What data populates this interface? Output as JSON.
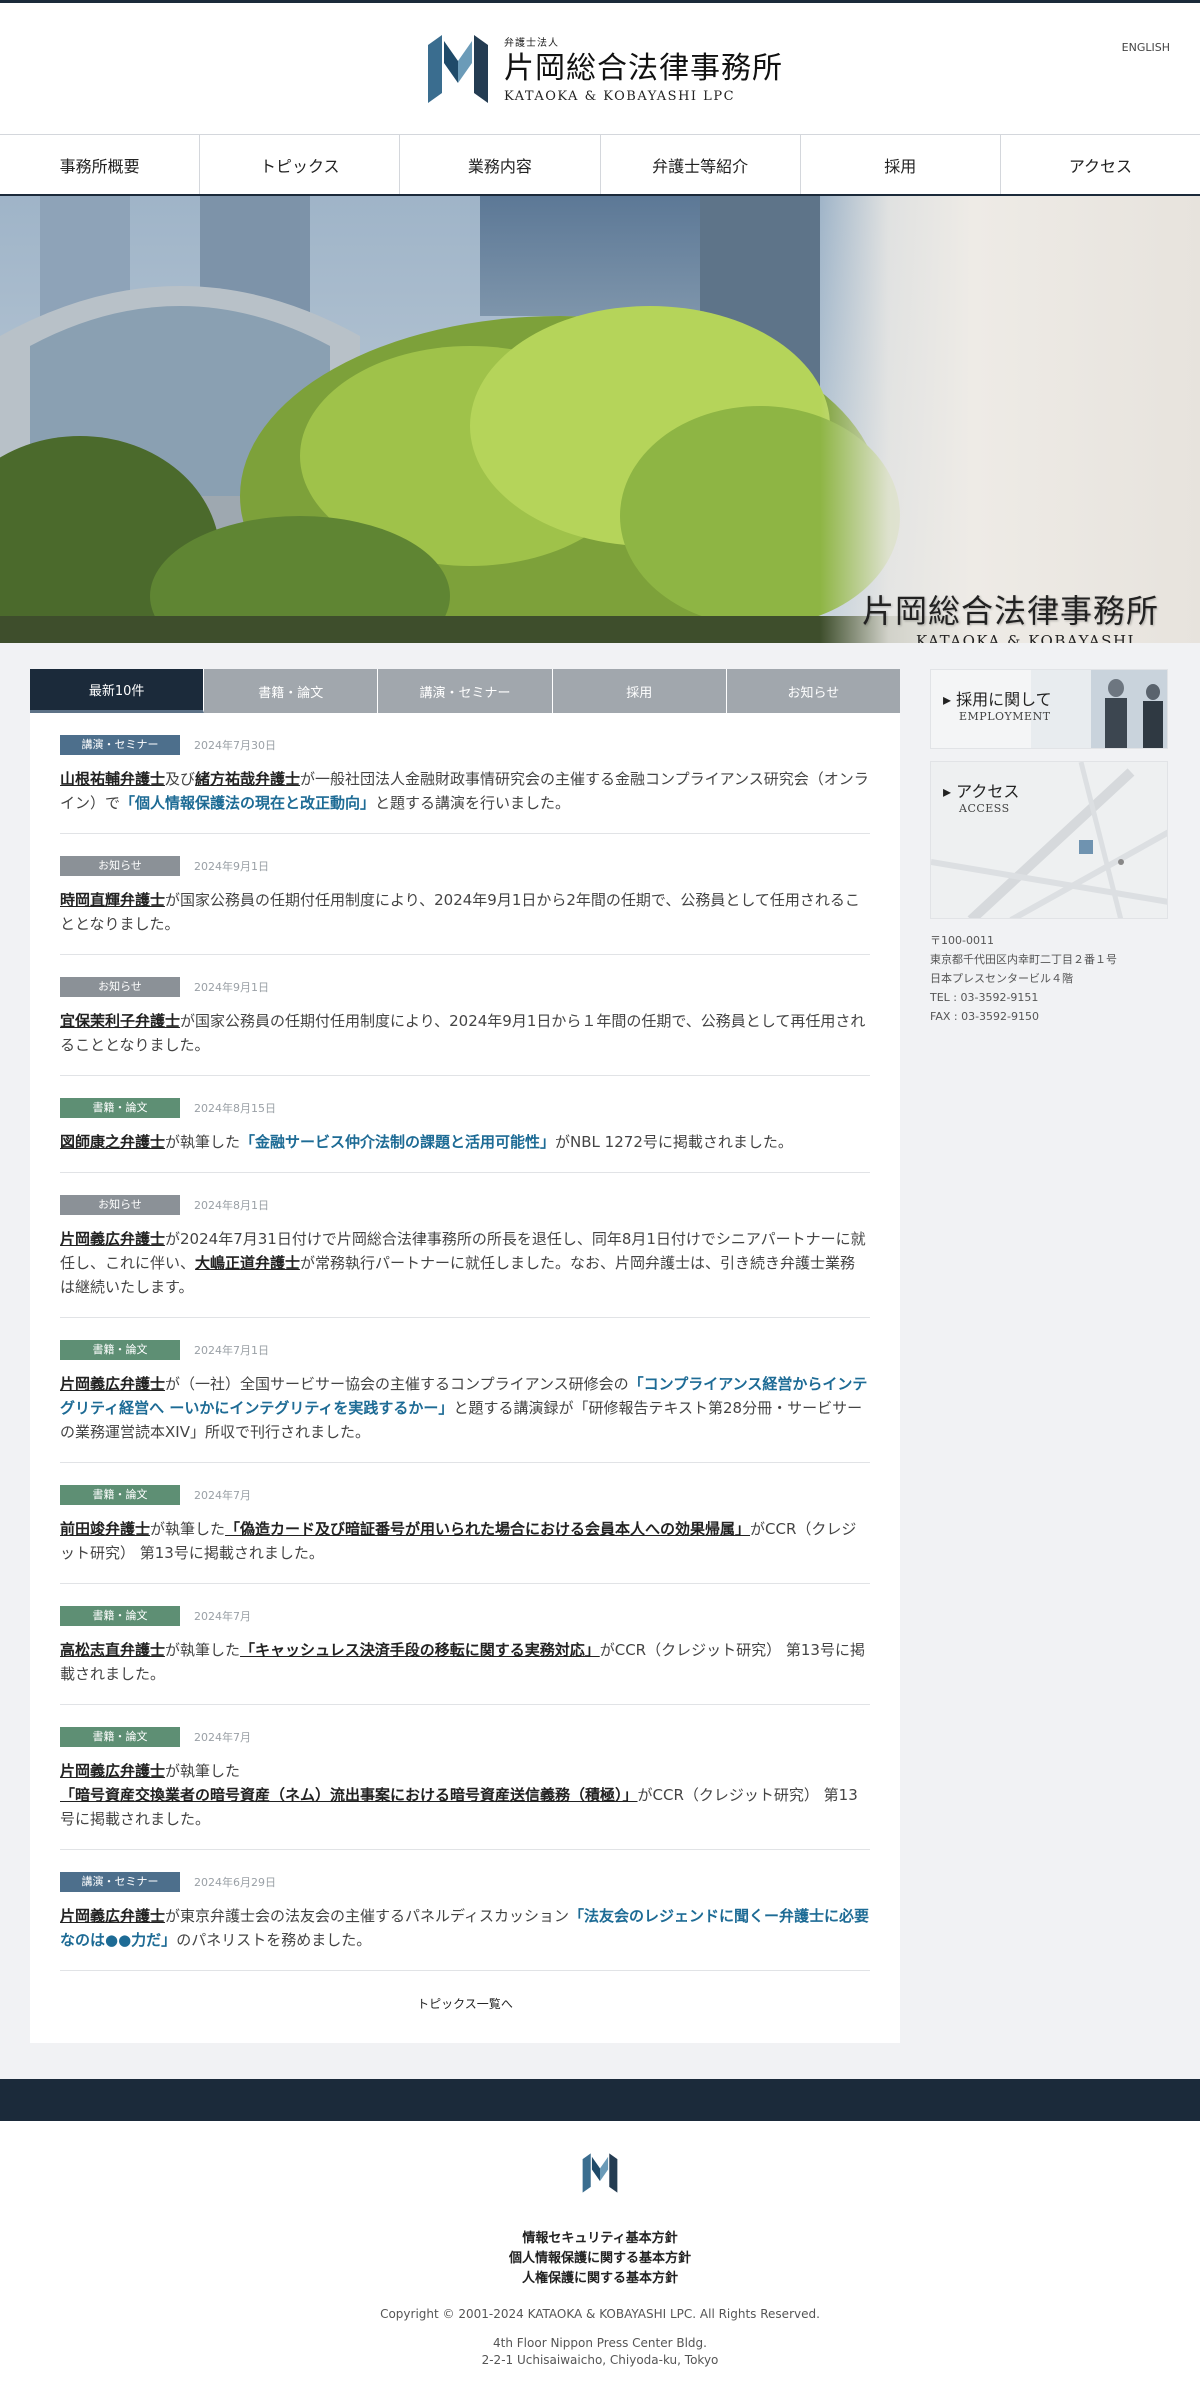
{
  "header": {
    "logo_small": "弁護士法人",
    "logo_name": "片岡総合法律事務所",
    "logo_en": "KATAOKA & KOBAYASHI LPC",
    "english_link": "ENGLISH"
  },
  "nav": [
    "事務所概要",
    "トピックス",
    "業務内容",
    "弁護士等紹介",
    "採用",
    "アクセス"
  ],
  "hero": {
    "title_jp": "片岡総合法律事務所",
    "title_en": "KATAOKA & KOBAYASHI"
  },
  "tabs": [
    "最新10件",
    "書籍・論文",
    "講演・セミナー",
    "採用",
    "お知らせ"
  ],
  "news": [
    {
      "category": "講演・セミナー",
      "date": "2024年7月30日",
      "p1": "山根祐輔弁護士",
      "t1": "及び",
      "p2": "緒方祐哉弁護士",
      "t2": "が一般社団法人金融財政事情研究会の主催する金融コンプライアンス研究会（オンライン）で",
      "l1": "「個人情報保護法の現在と改正動向」",
      "t3": "と題する講演を行いました。"
    },
    {
      "category": "お知らせ",
      "date": "2024年9月1日",
      "p1": "時岡直輝弁護士",
      "t1": "が国家公務員の任期付任用制度により、2024年9月1日から2年間の任期で、公務員として任用されることとなりました。"
    },
    {
      "category": "お知らせ",
      "date": "2024年9月1日",
      "p1": "宜保茉利子弁護士",
      "t1": "が国家公務員の任期付任用制度により、2024年9月1日から１年間の任期で、公務員として再任用されることとなりました。"
    },
    {
      "category": "書籍・論文",
      "date": "2024年8月15日",
      "p1": "図師康之弁護士",
      "t1": "が執筆した",
      "l1": "「金融サービス仲介法制の課題と活用可能性」",
      "t2": "がNBL 1272号に掲載されました。"
    },
    {
      "category": "お知らせ",
      "date": "2024年8月1日",
      "p1": "片岡義広弁護士",
      "t1": "が2024年7月31日付けで片岡総合法律事務所の所長を退任し、同年8月1日付けでシニアパートナーに就任し、これに伴い、",
      "p2": "大嶋正道弁護士",
      "t2": "が常務執行パートナーに就任しました。なお、片岡弁護士は、引き続き弁護士業務は継続いたします。"
    },
    {
      "category": "書籍・論文",
      "date": "2024年7月1日",
      "p1": "片岡義広弁護士",
      "t1": "が（一社）全国サービサー協会の主催するコンプライアンス研修会の",
      "l1": "「コンプライアンス経営からインテグリティ経営へ ーいかにインテグリティを実践するかー」",
      "t2": "と題する講演録が「研修報告テキスト第28分冊・サービサーの業務運営読本XIV」所収で刊行されました。"
    },
    {
      "category": "書籍・論文",
      "date": "2024年7月",
      "p1": "前田竣弁護士",
      "t1": "が執筆した",
      "u1": "「偽造カード及び暗証番号が用いられた場合における会員本人への効果帰属」",
      "t2": "がCCR（クレジット研究） 第13号に掲載されました。"
    },
    {
      "category": "書籍・論文",
      "date": "2024年7月",
      "p1": "高松志直弁護士",
      "t1": "が執筆した",
      "u1": "「キャッシュレス決済手段の移転に関する実務対応」",
      "t2": "がCCR（クレジット研究） 第13号に掲載されました。"
    },
    {
      "category": "書籍・論文",
      "date": "2024年7月",
      "p1": "片岡義広弁護士",
      "t1": "が執筆した",
      "u1": "「暗号資産交換業者の暗号資産（ネム）流出事案における暗号資産送信義務（積極）」",
      "t2": "がCCR（クレジット研究） 第13号に掲載されました。"
    },
    {
      "category": "講演・セミナー",
      "date": "2024年6月29日",
      "p1": "片岡義広弁護士",
      "t1": "が東京弁護士会の法友会の主催するパネルディスカッション",
      "l1": "「法友会のレジェンドに聞くー弁護士に必要なのは●●力だ」",
      "t2": "のパネリストを務めました。"
    }
  ],
  "more_link": "トピックス一覧へ",
  "side": {
    "recruit_title": "採用に関して",
    "recruit_sub": "EMPLOYMENT",
    "access_title": "アクセス",
    "access_sub": "ACCESS",
    "address": [
      "〒100-0011",
      "東京都千代田区内幸町二丁目２番１号",
      "日本プレスセンタービル４階",
      "TEL : 03-3592-9151",
      "FAX : 03-3592-9150"
    ]
  },
  "footer": {
    "links": [
      "情報セキュリティ基本方針",
      "個人情報保護に関する基本方針",
      "人権保護に関する基本方針"
    ],
    "copyright": "Copyright © 2001-2024 KATAOKA & KOBAYASHI LPC. All Rights Reserved.",
    "address": [
      "4th Floor Nippon Press Center Bldg.",
      "2-2-1 Uchisaiwaicho, Chiyoda-ku, Tokyo"
    ]
  },
  "colors": {
    "navy": "#1b2a3a",
    "seminar": "#4d6f8c",
    "notice": "#8b9197",
    "book": "#5e8f74",
    "link": "#1d6b95"
  }
}
